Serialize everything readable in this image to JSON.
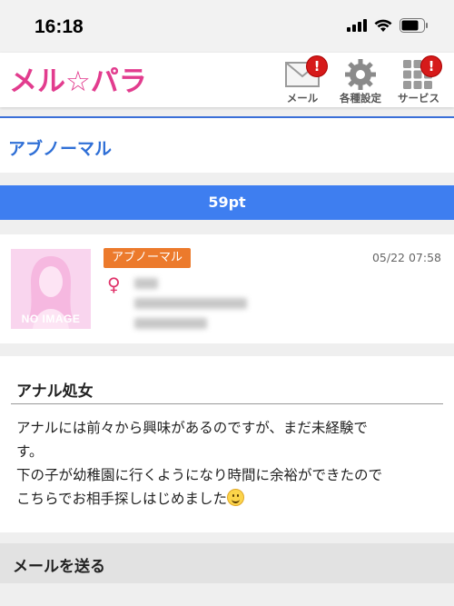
{
  "status_bar": {
    "time": "16:18"
  },
  "header": {
    "logo_text": "メル☆パラ",
    "mail_label": "メール",
    "settings_label": "各種設定",
    "services_label": "サービス",
    "badge_text": "!"
  },
  "category": {
    "title": "アブノーマル"
  },
  "points": {
    "text": "59pt"
  },
  "profile": {
    "avatar_text": "NO IMAGE",
    "category_badge": "アブノーマル",
    "date": "05/22 07:58"
  },
  "post": {
    "title": "アナル処女",
    "line1": "アナルには前々から興味があるのですが、まだ未経験で",
    "line2": "す。",
    "line3": "下の子が幼稚園に行くようになり時間に余裕ができたので",
    "line4": "こちらでお相手探しはじめました"
  },
  "send_mail": {
    "label": "メールを送る"
  },
  "colors": {
    "accent_blue": "#3e7ef0",
    "title_blue": "#2f6fd6",
    "badge_orange": "#ec7a2c",
    "alert_red": "#d61a1a",
    "logo_pink": "#e23c8e"
  }
}
